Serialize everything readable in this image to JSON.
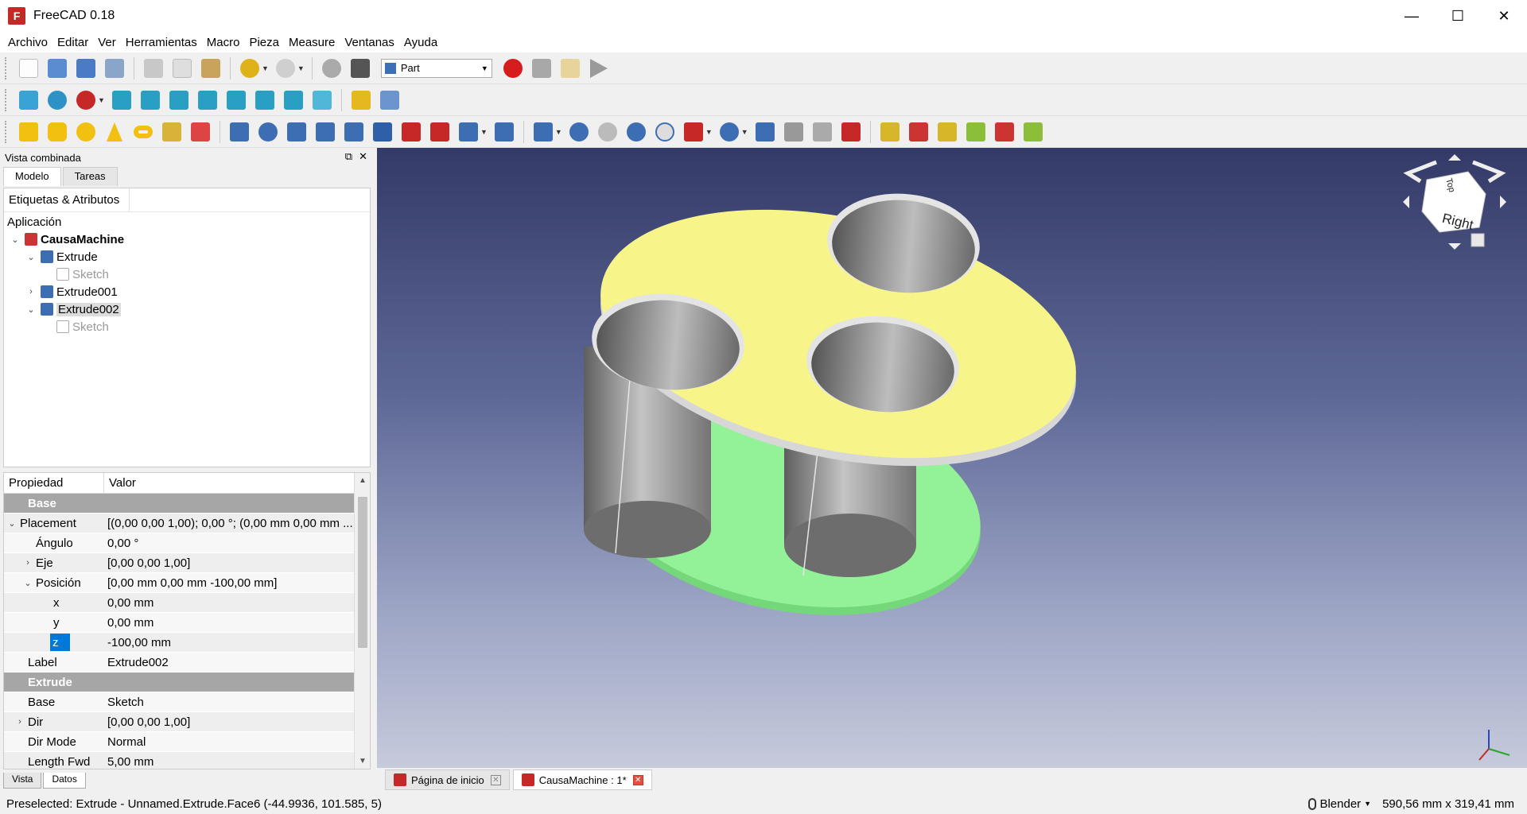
{
  "window": {
    "title": "FreeCAD 0.18",
    "minimize": "—",
    "maximize": "☐",
    "close": "✕"
  },
  "menu": [
    "Archivo",
    "Editar",
    "Ver",
    "Herramientas",
    "Macro",
    "Pieza",
    "Measure",
    "Ventanas",
    "Ayuda"
  ],
  "toolbar": {
    "workbench": "Part"
  },
  "combo": {
    "title": "Vista combinada",
    "tabs": [
      "Modelo",
      "Tareas"
    ],
    "tree_header": "Etiquetas & Atributos",
    "section": "Aplicación",
    "tree": [
      {
        "label": "CausaMachine",
        "level": 0,
        "expanded": true
      },
      {
        "label": "Extrude",
        "level": 1,
        "expanded": true
      },
      {
        "label": "Sketch",
        "level": 2
      },
      {
        "label": "Extrude001",
        "level": 1,
        "expanded": false
      },
      {
        "label": "Extrude002",
        "level": 1,
        "expanded": true,
        "selected": true
      },
      {
        "label": "Sketch",
        "level": 2
      }
    ]
  },
  "properties": {
    "col_property": "Propiedad",
    "col_value": "Valor",
    "rows": [
      {
        "group": "Base"
      },
      {
        "name": "Placement",
        "value": "[(0,00 0,00 1,00); 0,00 °; (0,00 mm  0,00 mm ...",
        "indent": 0,
        "arrow": "v"
      },
      {
        "name": "Ángulo",
        "value": "0,00 °",
        "indent": 1
      },
      {
        "name": "Eje",
        "value": "[0,00 0,00 1,00]",
        "indent": 1,
        "arrow": ">"
      },
      {
        "name": "Posición",
        "value": "[0,00 mm  0,00 mm  -100,00 mm]",
        "indent": 1,
        "arrow": "v"
      },
      {
        "name": "x",
        "value": "0,00 mm",
        "indent": 2
      },
      {
        "name": "y",
        "value": "0,00 mm",
        "indent": 2
      },
      {
        "name": "z",
        "value": "-100,00 mm",
        "indent": 2,
        "highlight": true
      },
      {
        "name": "Label",
        "value": "Extrude002",
        "indent": 0
      },
      {
        "group": "Extrude"
      },
      {
        "name": "Base",
        "value": "Sketch",
        "indent": 0
      },
      {
        "name": "Dir",
        "value": "[0,00 0,00 1,00]",
        "indent": 0,
        "arrow": ">"
      },
      {
        "name": "Dir Mode",
        "value": "Normal",
        "indent": 0
      },
      {
        "name": "Length Fwd",
        "value": "5,00 mm",
        "indent": 0
      }
    ]
  },
  "panel_tabs": [
    "Vista",
    "Datos"
  ],
  "navcube": {
    "top": "Top",
    "face": "Right"
  },
  "doc_tabs": [
    {
      "label": "Página de inicio",
      "active": false
    },
    {
      "label": "CausaMachine : 1*",
      "active": true
    }
  ],
  "status": {
    "message": "Preselected: Extrude - Unnamed.Extrude.Face6 (-44.9936, 101.585, 5)",
    "nav_style": "Blender",
    "dimensions": "590,56 mm x 319,41 mm"
  },
  "colors": {
    "top_plate": "#f7f58a",
    "bottom_plate": "#92f097",
    "cylinder": "#9e9e9e"
  }
}
